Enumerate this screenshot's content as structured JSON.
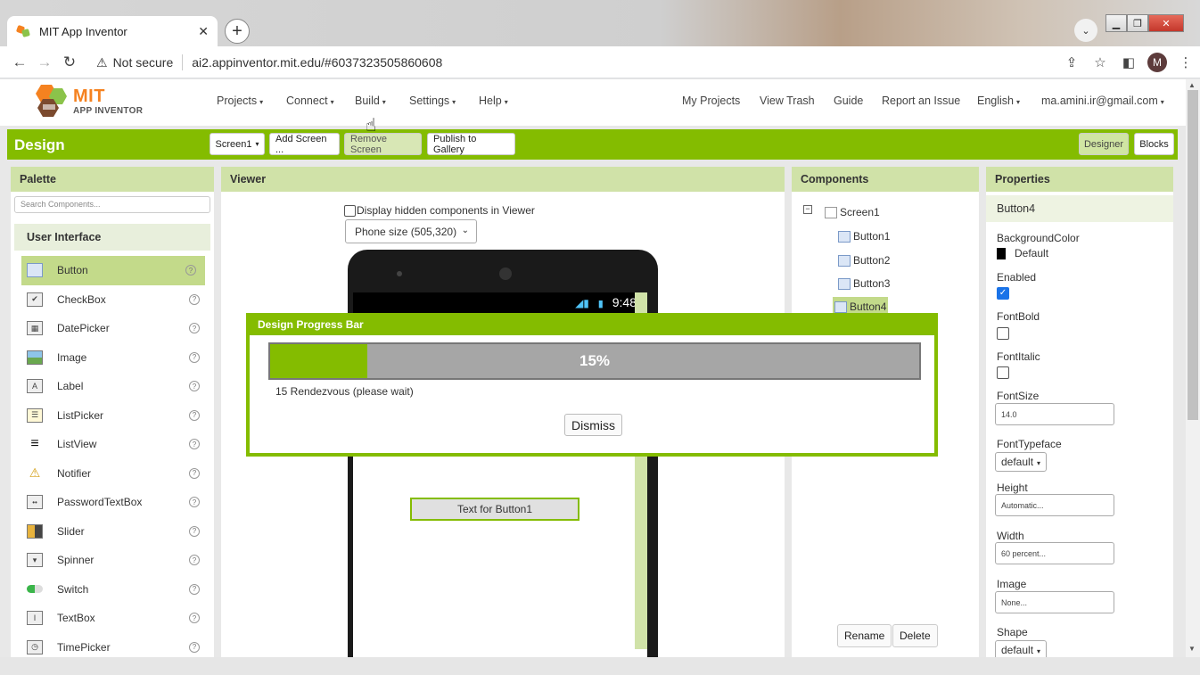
{
  "browser": {
    "tab_title": "MIT App Inventor",
    "tab_close": "✕",
    "new_tab": "+",
    "security": "Not secure",
    "url": "ai2.appinventor.mit.edu/#6037323505860608",
    "profile_initial": "M"
  },
  "app": {
    "logo_mit": "MIT",
    "logo_sub": "APP INVENTOR",
    "menu": [
      "Projects",
      "Connect",
      "Build",
      "Settings",
      "Help"
    ],
    "right_links": [
      "My Projects",
      "View Trash",
      "Guide",
      "Report an Issue",
      "English",
      "ma.amini.ir@gmail.com"
    ]
  },
  "design_bar": {
    "title": "Design",
    "screen_select": "Screen1",
    "add_screen": "Add Screen ...",
    "remove_screen": "Remove Screen",
    "publish": "Publish to Gallery",
    "designer": "Designer",
    "blocks": "Blocks"
  },
  "palette": {
    "title": "Palette",
    "search_placeholder": "Search Components...",
    "category": "User Interface",
    "items": [
      {
        "label": "Button",
        "icon": "button-icon"
      },
      {
        "label": "CheckBox",
        "icon": "checkbox-icon"
      },
      {
        "label": "DatePicker",
        "icon": "datepicker-icon"
      },
      {
        "label": "Image",
        "icon": "image-icon"
      },
      {
        "label": "Label",
        "icon": "label-icon"
      },
      {
        "label": "ListPicker",
        "icon": "listpicker-icon"
      },
      {
        "label": "ListView",
        "icon": "listview-icon"
      },
      {
        "label": "Notifier",
        "icon": "notifier-icon"
      },
      {
        "label": "PasswordTextBox",
        "icon": "passwordtextbox-icon"
      },
      {
        "label": "Slider",
        "icon": "slider-icon"
      },
      {
        "label": "Spinner",
        "icon": "spinner-icon"
      },
      {
        "label": "Switch",
        "icon": "switch-icon"
      },
      {
        "label": "TextBox",
        "icon": "textbox-icon"
      },
      {
        "label": "TimePicker",
        "icon": "timepicker-icon"
      }
    ],
    "help_glyph": "?"
  },
  "viewer": {
    "title": "Viewer",
    "hidden_label": "Display hidden components in Viewer",
    "phone_size": "Phone size (505,320)",
    "status_time": "9:48",
    "button_text": "Text for Button1"
  },
  "components": {
    "title": "Components",
    "tree": [
      "Screen1",
      "Button1",
      "Button2",
      "Button3",
      "Button4"
    ],
    "rename": "Rename",
    "delete": "Delete"
  },
  "properties": {
    "title": "Properties",
    "component": "Button4",
    "background_color_label": "BackgroundColor",
    "background_color_value": "Default",
    "enabled_label": "Enabled",
    "fontbold_label": "FontBold",
    "fontitalic_label": "FontItalic",
    "fontsize_label": "FontSize",
    "fontsize_value": "14.0",
    "fonttypeface_label": "FontTypeface",
    "fonttypeface_value": "default",
    "height_label": "Height",
    "height_value": "Automatic...",
    "width_label": "Width",
    "width_value": "60 percent...",
    "image_label": "Image",
    "image_value": "None...",
    "shape_label": "Shape",
    "shape_value": "default"
  },
  "dialog": {
    "title": "Design Progress Bar",
    "progress_percent": 15,
    "progress_text": "15%",
    "status": "15 Rendezvous (please wait)",
    "dismiss": "Dismiss"
  },
  "colors": {
    "accent": "#84bc00",
    "header_light": "#d0e2a8"
  }
}
